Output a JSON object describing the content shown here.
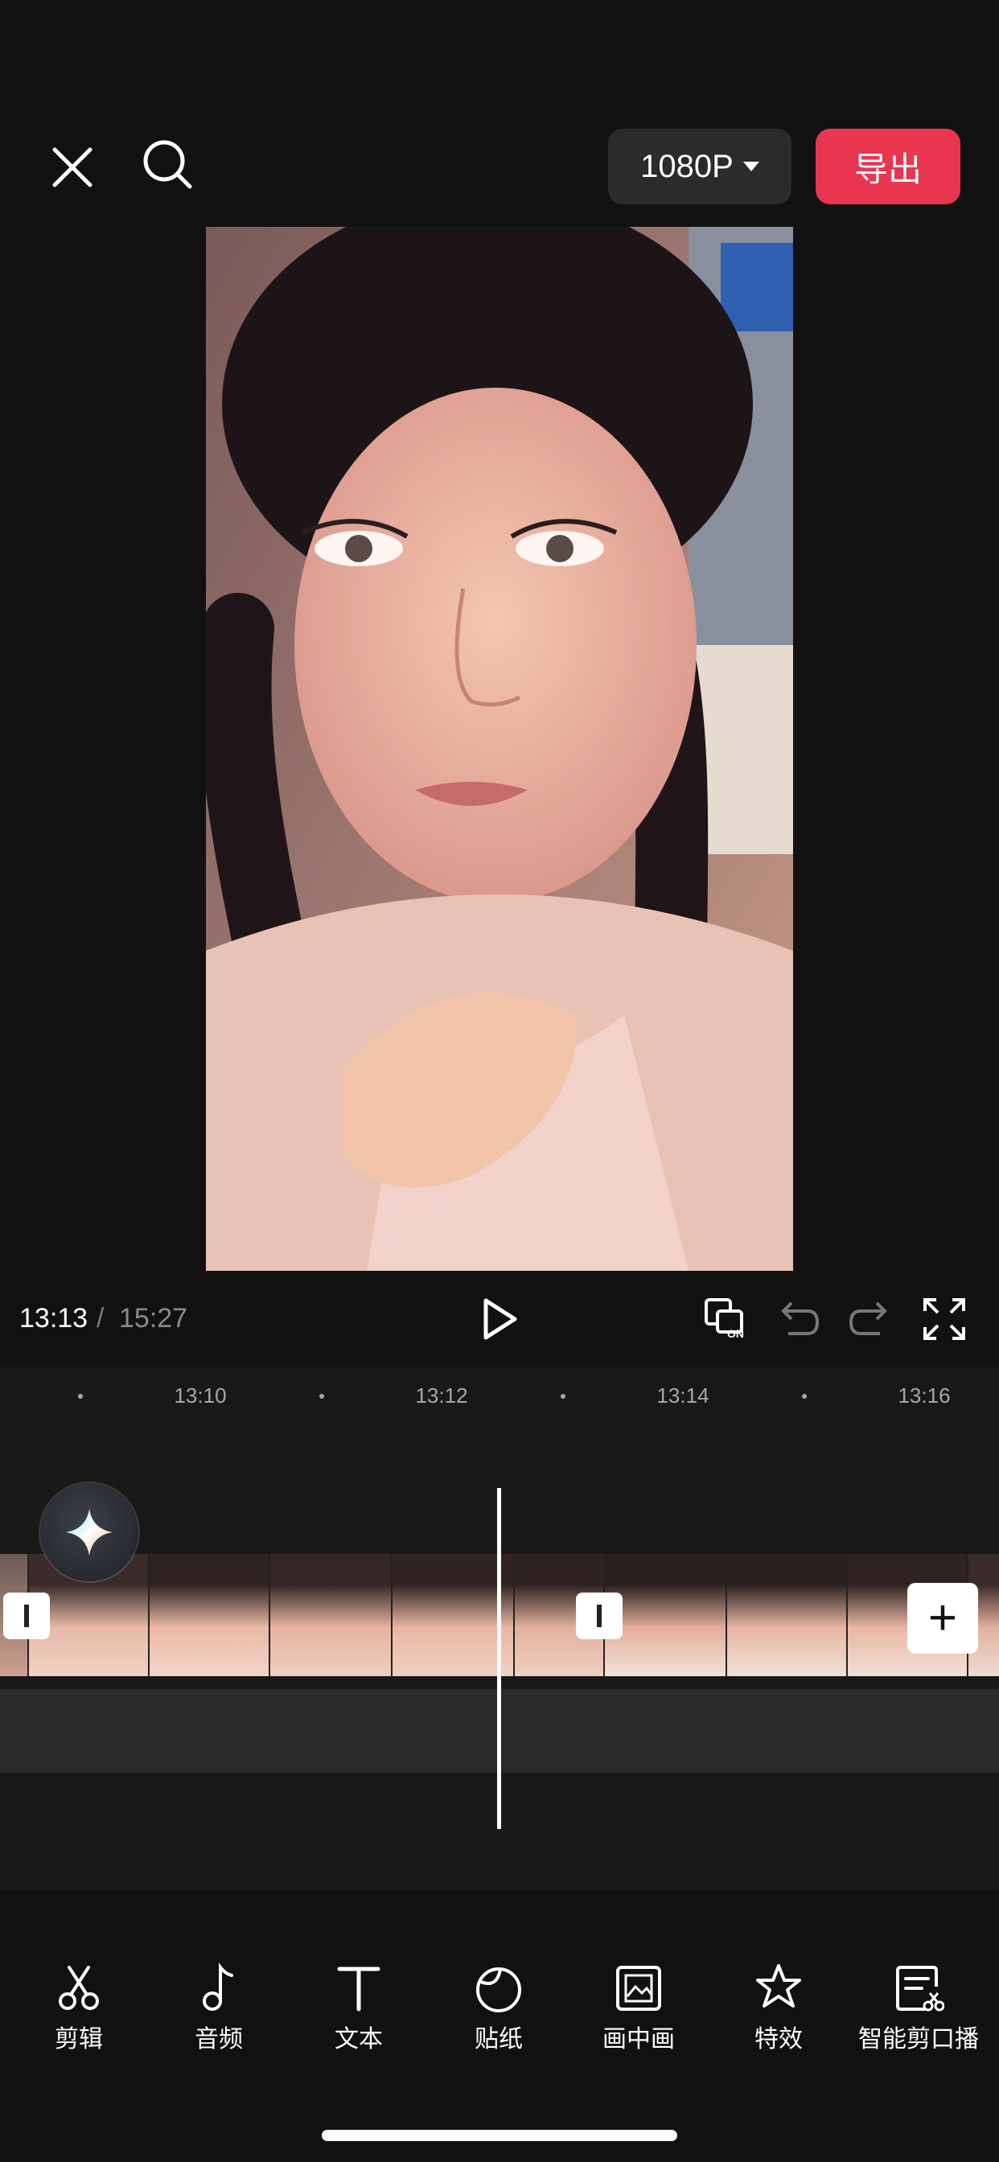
{
  "header": {
    "resolution_label": "1080P",
    "export_label": "导出",
    "close_icon": "close-icon",
    "search_icon": "search-icon"
  },
  "player": {
    "current_time": "13:13",
    "separator": "/",
    "total_time": "15:27",
    "compare_label": "ON",
    "icons": [
      "play-icon",
      "compare-on-icon",
      "undo-icon",
      "redo-icon",
      "fullscreen-icon"
    ]
  },
  "timeline": {
    "ruler_labels": [
      "13:10",
      "13:12",
      "13:14",
      "13:16"
    ],
    "add_clip_label": "+"
  },
  "toolbar": {
    "items": [
      {
        "label": "剪辑",
        "icon": "scissors-icon"
      },
      {
        "label": "音频",
        "icon": "music-note-icon"
      },
      {
        "label": "文本",
        "icon": "text-icon"
      },
      {
        "label": "贴纸",
        "icon": "sticker-icon"
      },
      {
        "label": "画中画",
        "icon": "picture-in-picture-icon"
      },
      {
        "label": "特效",
        "icon": "effects-star-icon"
      },
      {
        "label": "智能剪口播",
        "icon": "smart-edit-icon"
      }
    ]
  },
  "colors": {
    "background": "#111111",
    "export_button": "#e93550",
    "resolution_button": "#2b2b2b",
    "accent_white": "#ffffff"
  }
}
